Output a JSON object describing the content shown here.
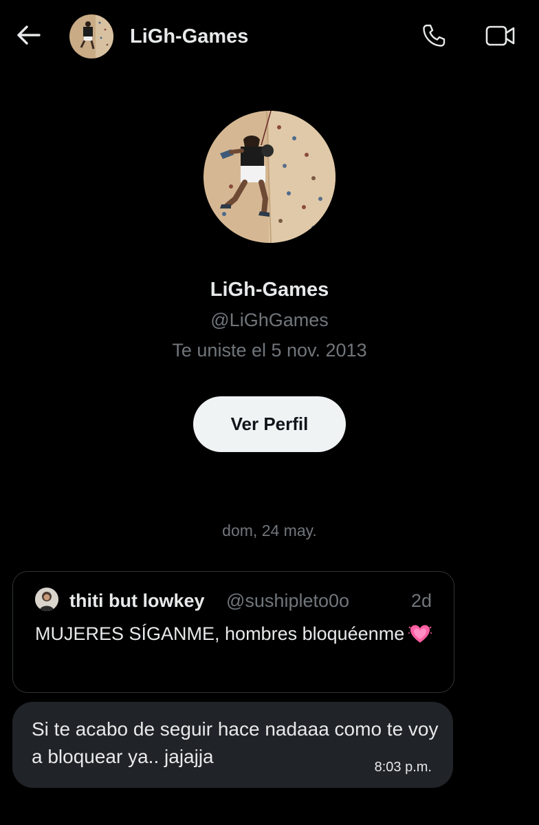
{
  "header": {
    "title": "LiGh-Games",
    "back_icon": "arrow-left-icon",
    "call_icon": "phone-icon",
    "video_icon": "video-camera-icon"
  },
  "profile": {
    "name": "LiGh-Games",
    "handle": "@LiGhGames",
    "joined": "Te uniste el 5 nov. 2013",
    "view_profile_label": "Ver Perfil"
  },
  "conversation": {
    "date_separator": "dom, 24 may.",
    "quoted_post": {
      "author_name": "thiti but lowkey",
      "author_handle": "@sushipleto0o",
      "time": "2d",
      "text": "MUJERES SÍGANME, hombres bloquéenme",
      "emoji": "heart-emoji"
    },
    "message": {
      "text": "Si te acabo de seguir hace nadaaa como te voy a bloquear ya.. jajajja",
      "time": "8:03 p.m."
    }
  },
  "colors": {
    "background": "#000000",
    "primary_text": "#e7e9ea",
    "secondary_text": "#71767b",
    "bubble": "#202327",
    "button_bg": "#eff3f4",
    "heart": "#ff5fa2"
  }
}
